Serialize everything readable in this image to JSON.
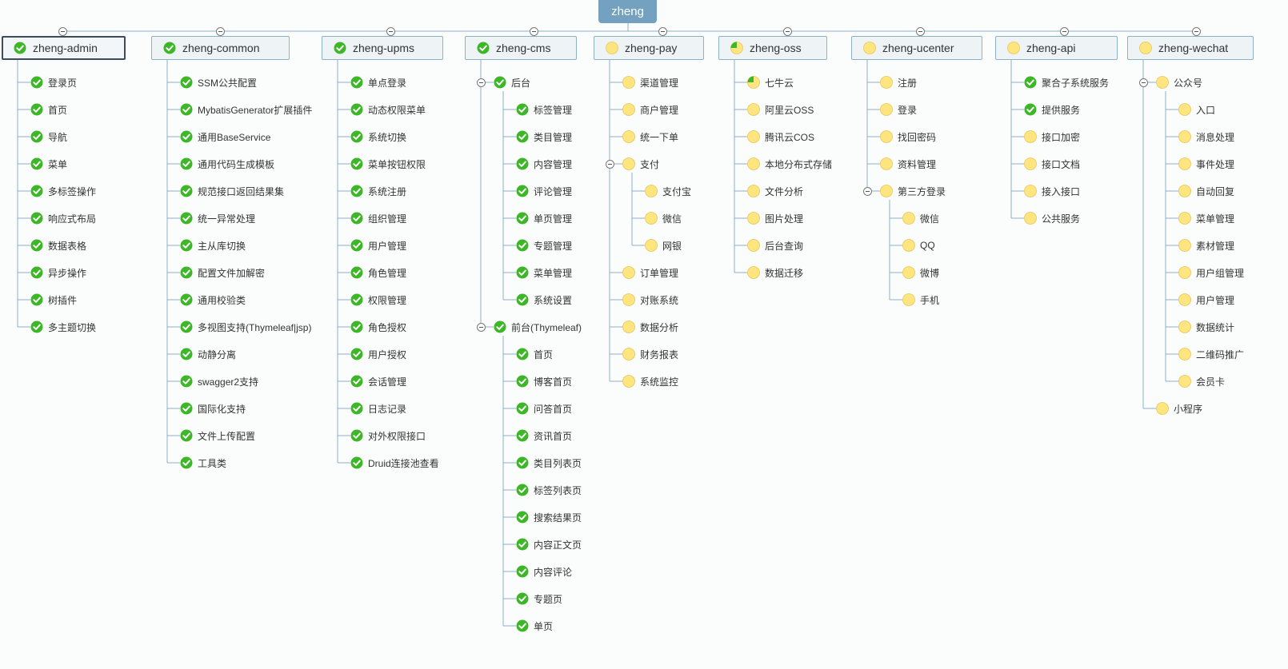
{
  "root": {
    "label": "zheng"
  },
  "colors": {
    "done": "#3db628",
    "todo": "#ffe57f",
    "partial": "#ffe57f",
    "line": "#8fb1c8"
  },
  "modules": [
    {
      "label": "zheng-admin",
      "status": "done",
      "selected": true,
      "items": [
        {
          "label": "登录页",
          "status": "done"
        },
        {
          "label": "首页",
          "status": "done"
        },
        {
          "label": "导航",
          "status": "done"
        },
        {
          "label": "菜单",
          "status": "done"
        },
        {
          "label": "多标签操作",
          "status": "done"
        },
        {
          "label": "响应式布局",
          "status": "done"
        },
        {
          "label": "数据表格",
          "status": "done"
        },
        {
          "label": "异步操作",
          "status": "done"
        },
        {
          "label": "树插件",
          "status": "done"
        },
        {
          "label": "多主题切换",
          "status": "done"
        }
      ]
    },
    {
      "label": "zheng-common",
      "status": "done",
      "items": [
        {
          "label": "SSM公共配置",
          "status": "done"
        },
        {
          "label": "MybatisGenerator扩展插件",
          "status": "done"
        },
        {
          "label": "通用BaseService",
          "status": "done"
        },
        {
          "label": "通用代码生成模板",
          "status": "done"
        },
        {
          "label": "规范接口返回结果集",
          "status": "done"
        },
        {
          "label": "统一异常处理",
          "status": "done"
        },
        {
          "label": "主从库切换",
          "status": "done"
        },
        {
          "label": "配置文件加解密",
          "status": "done"
        },
        {
          "label": "通用校验类",
          "status": "done"
        },
        {
          "label": "多视图支持(Thymeleaf|jsp)",
          "status": "done"
        },
        {
          "label": "动静分离",
          "status": "done"
        },
        {
          "label": "swagger2支持",
          "status": "done"
        },
        {
          "label": "国际化支持",
          "status": "done"
        },
        {
          "label": "文件上传配置",
          "status": "done"
        },
        {
          "label": "工具类",
          "status": "done"
        }
      ]
    },
    {
      "label": "zheng-upms",
      "status": "done",
      "items": [
        {
          "label": "单点登录",
          "status": "done"
        },
        {
          "label": "动态权限菜单",
          "status": "done"
        },
        {
          "label": "系统切换",
          "status": "done"
        },
        {
          "label": "菜单按钮权限",
          "status": "done"
        },
        {
          "label": "系统注册",
          "status": "done"
        },
        {
          "label": "组织管理",
          "status": "done"
        },
        {
          "label": "用户管理",
          "status": "done"
        },
        {
          "label": "角色管理",
          "status": "done"
        },
        {
          "label": "权限管理",
          "status": "done"
        },
        {
          "label": "角色授权",
          "status": "done"
        },
        {
          "label": "用户授权",
          "status": "done"
        },
        {
          "label": "会话管理",
          "status": "done"
        },
        {
          "label": "日志记录",
          "status": "done"
        },
        {
          "label": "对外权限接口",
          "status": "done"
        },
        {
          "label": "Druid连接池查看",
          "status": "done"
        }
      ]
    },
    {
      "label": "zheng-cms",
      "status": "done",
      "items": [
        {
          "label": "后台",
          "status": "done",
          "children": [
            {
              "label": "标签管理",
              "status": "done"
            },
            {
              "label": "类目管理",
              "status": "done"
            },
            {
              "label": "内容管理",
              "status": "done"
            },
            {
              "label": "评论管理",
              "status": "done"
            },
            {
              "label": "单页管理",
              "status": "done"
            },
            {
              "label": "专题管理",
              "status": "done"
            },
            {
              "label": "菜单管理",
              "status": "done"
            },
            {
              "label": "系统设置",
              "status": "done"
            }
          ]
        },
        {
          "label": "前台(Thymeleaf)",
          "status": "done",
          "children": [
            {
              "label": "首页",
              "status": "done"
            },
            {
              "label": "博客首页",
              "status": "done"
            },
            {
              "label": "问答首页",
              "status": "done"
            },
            {
              "label": "资讯首页",
              "status": "done"
            },
            {
              "label": "类目列表页",
              "status": "done"
            },
            {
              "label": "标签列表页",
              "status": "done"
            },
            {
              "label": "搜索结果页",
              "status": "done"
            },
            {
              "label": "内容正文页",
              "status": "done"
            },
            {
              "label": "内容评论",
              "status": "done"
            },
            {
              "label": "专题页",
              "status": "done"
            },
            {
              "label": "单页",
              "status": "done"
            }
          ]
        }
      ]
    },
    {
      "label": "zheng-pay",
      "status": "todo",
      "items": [
        {
          "label": "渠道管理",
          "status": "todo"
        },
        {
          "label": "商户管理",
          "status": "todo"
        },
        {
          "label": "统一下单",
          "status": "todo"
        },
        {
          "label": "支付",
          "status": "todo",
          "children": [
            {
              "label": "支付宝",
              "status": "todo"
            },
            {
              "label": "微信",
              "status": "todo"
            },
            {
              "label": "网银",
              "status": "todo"
            }
          ]
        },
        {
          "label": "订单管理",
          "status": "todo"
        },
        {
          "label": "对账系统",
          "status": "todo"
        },
        {
          "label": "数据分析",
          "status": "todo"
        },
        {
          "label": "财务报表",
          "status": "todo"
        },
        {
          "label": "系统监控",
          "status": "todo"
        }
      ]
    },
    {
      "label": "zheng-oss",
      "status": "partial",
      "items": [
        {
          "label": "七牛云",
          "status": "partial"
        },
        {
          "label": "阿里云OSS",
          "status": "todo"
        },
        {
          "label": "腾讯云COS",
          "status": "todo"
        },
        {
          "label": "本地分布式存储",
          "status": "todo"
        },
        {
          "label": "文件分析",
          "status": "todo"
        },
        {
          "label": "图片处理",
          "status": "todo"
        },
        {
          "label": "后台查询",
          "status": "todo"
        },
        {
          "label": "数据迁移",
          "status": "todo"
        }
      ]
    },
    {
      "label": "zheng-ucenter",
      "status": "todo",
      "items": [
        {
          "label": "注册",
          "status": "todo"
        },
        {
          "label": "登录",
          "status": "todo"
        },
        {
          "label": "找回密码",
          "status": "todo"
        },
        {
          "label": "资料管理",
          "status": "todo"
        },
        {
          "label": "第三方登录",
          "status": "todo",
          "children": [
            {
              "label": "微信",
              "status": "todo"
            },
            {
              "label": "QQ",
              "status": "todo"
            },
            {
              "label": "微博",
              "status": "todo"
            },
            {
              "label": "手机",
              "status": "todo"
            }
          ]
        }
      ]
    },
    {
      "label": "zheng-api",
      "status": "todo",
      "items": [
        {
          "label": "聚合子系统服务",
          "status": "done"
        },
        {
          "label": "提供服务",
          "status": "done"
        },
        {
          "label": "接口加密",
          "status": "todo"
        },
        {
          "label": "接口文档",
          "status": "todo"
        },
        {
          "label": "接入接口",
          "status": "todo"
        },
        {
          "label": "公共服务",
          "status": "todo"
        }
      ]
    },
    {
      "label": "zheng-wechat",
      "status": "todo",
      "items": [
        {
          "label": "公众号",
          "status": "todo",
          "children": [
            {
              "label": "入口",
              "status": "todo"
            },
            {
              "label": "消息处理",
              "status": "todo"
            },
            {
              "label": "事件处理",
              "status": "todo"
            },
            {
              "label": "自动回复",
              "status": "todo"
            },
            {
              "label": "菜单管理",
              "status": "todo"
            },
            {
              "label": "素材管理",
              "status": "todo"
            },
            {
              "label": "用户组管理",
              "status": "todo"
            },
            {
              "label": "用户管理",
              "status": "todo"
            },
            {
              "label": "数据统计",
              "status": "todo"
            },
            {
              "label": "二维码推广",
              "status": "todo"
            },
            {
              "label": "会员卡",
              "status": "todo"
            }
          ]
        },
        {
          "label": "小程序",
          "status": "todo"
        }
      ]
    }
  ]
}
